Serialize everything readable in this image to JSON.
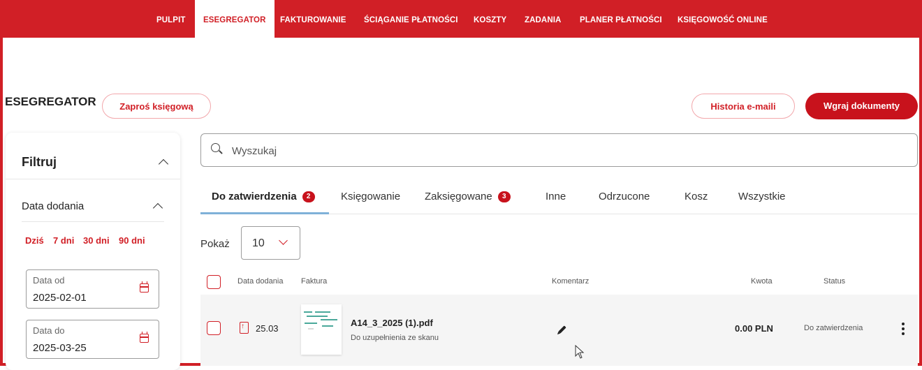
{
  "nav": {
    "items": [
      "PULPIT",
      "ESEGREGATOR",
      "FAKTUROWANIE",
      "ŚCIĄGANIE PŁATNOŚCI",
      "KOSZTY",
      "ZADANIA",
      "PLANER PŁATNOŚCI",
      "KSIĘGOWOŚĆ ONLINE"
    ],
    "active": "ESEGREGATOR"
  },
  "header": {
    "title": "ESEGREGATOR",
    "ask_accountant": "Zaproś księgową",
    "email_history": "Historia e-maili",
    "upload": "Wgraj dokumenty"
  },
  "filter": {
    "title": "Filtruj",
    "date_section": "Data dodania",
    "quick": [
      "Dziś",
      "7 dni",
      "30 dni",
      "90 dni"
    ],
    "date_from_label": "Data od",
    "date_from": "2025-02-01",
    "date_to_label": "Data do",
    "date_to": "2025-03-25"
  },
  "search": {
    "placeholder": "Wyszukaj"
  },
  "tabs": [
    {
      "label": "Do zatwierdzenia",
      "badge": "2"
    },
    {
      "label": "Księgowanie",
      "badge": ""
    },
    {
      "label": "Zaksięgowane",
      "badge": "3"
    },
    {
      "label": "Inne",
      "badge": ""
    },
    {
      "label": "Odrzucone",
      "badge": ""
    },
    {
      "label": "Kosz",
      "badge": ""
    },
    {
      "label": "Wszystkie",
      "badge": ""
    }
  ],
  "pagination": {
    "show_label": "Pokaż",
    "page_size": "10"
  },
  "table": {
    "headers": {
      "date": "Data dodania",
      "invoice": "Faktura",
      "comment": "Komentarz",
      "amount": "Kwota",
      "status": "Status"
    },
    "rows": [
      {
        "date": "25.03",
        "filename": "A14_3_2025 (1).pdf",
        "subtitle": "Do uzupełnienia ze skanu",
        "amount": "0.00 PLN",
        "status": "Do zatwierdzenia"
      }
    ]
  },
  "colors": {
    "brand": "#d11f26",
    "accent_tab": "#7fb1d8"
  }
}
